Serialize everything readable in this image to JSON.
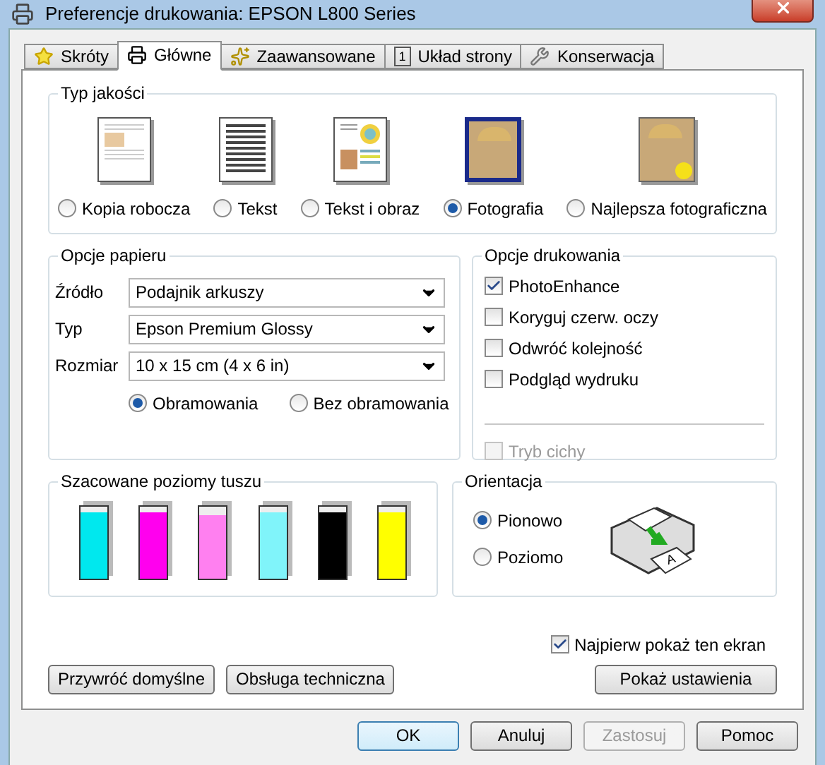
{
  "window": {
    "title": "Preferencje drukowania: EPSON L800 Series"
  },
  "tabs": [
    {
      "label": "Skróty",
      "selected": false
    },
    {
      "label": "Główne",
      "selected": true
    },
    {
      "label": "Zaawansowane",
      "selected": false
    },
    {
      "label": "Układ strony",
      "selected": false,
      "icon_text": "1"
    },
    {
      "label": "Konserwacja",
      "selected": false
    }
  ],
  "quality": {
    "title": "Typ jakości",
    "options": [
      {
        "label": "Kopia robocza",
        "kind": "draft",
        "selected": false
      },
      {
        "label": "Tekst",
        "kind": "text",
        "selected": false
      },
      {
        "label": "Tekst i obraz",
        "kind": "mixed",
        "selected": false
      },
      {
        "label": "Fotografia",
        "kind": "photo",
        "selected": true
      },
      {
        "label": "Najlepsza fotograficzna",
        "kind": "best",
        "selected": false
      }
    ]
  },
  "paper": {
    "title": "Opcje papieru",
    "fields": [
      {
        "label": "Źródło",
        "value": "Podajnik arkuszy"
      },
      {
        "label": "Typ",
        "value": "Epson Premium Glossy"
      },
      {
        "label": "Rozmiar",
        "value": "10 x 15 cm (4 x 6 in)"
      }
    ],
    "borders": [
      {
        "label": "Obramowania",
        "selected": true
      },
      {
        "label": "Bez obramowania",
        "selected": false
      }
    ]
  },
  "print_options": {
    "title": "Opcje drukowania",
    "checks": [
      {
        "label": "PhotoEnhance",
        "checked": true
      },
      {
        "label": "Koryguj czerw. oczy",
        "checked": false
      },
      {
        "label": "Odwróć kolejność",
        "checked": false
      },
      {
        "label": "Podgląd wydruku",
        "checked": false
      }
    ],
    "quiet": {
      "label": "Tryb cichy",
      "checked": false,
      "disabled": true
    }
  },
  "ink": {
    "title": "Szacowane poziomy tuszu",
    "cartridges": [
      {
        "color": "#00e8ee",
        "level": 0.92
      },
      {
        "color": "#ff00ee",
        "level": 0.92
      },
      {
        "color": "#ff80f0",
        "level": 0.88
      },
      {
        "color": "#80f4fa",
        "level": 0.92
      },
      {
        "color": "#000000",
        "level": 0.92
      },
      {
        "color": "#ffff00",
        "level": 0.92
      }
    ]
  },
  "orientation": {
    "title": "Orientacja",
    "paper_letter": "A",
    "options": [
      {
        "label": "Pionowo",
        "selected": true
      },
      {
        "label": "Poziomo",
        "selected": false
      }
    ]
  },
  "show_first": {
    "label": "Najpierw pokaż ten ekran",
    "checked": true
  },
  "buttons": [
    {
      "label": "Przywróć domyślne"
    },
    {
      "label": "Obsługa techniczna"
    }
  ],
  "show_settings": {
    "label": "Pokaż ustawienia"
  },
  "dialog_buttons": [
    {
      "label": "OK",
      "default": true,
      "disabled": false
    },
    {
      "label": "Anuluj",
      "default": false,
      "disabled": false
    },
    {
      "label": "Zastosuj",
      "default": false,
      "disabled": true
    },
    {
      "label": "Pomoc",
      "default": false,
      "disabled": false
    }
  ]
}
